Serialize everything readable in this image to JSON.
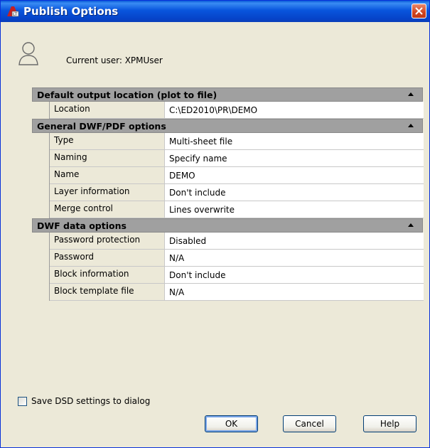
{
  "window": {
    "title": "Publish Options",
    "icons": {
      "app": "autocad-lt-icon",
      "close": "close-icon"
    }
  },
  "user": {
    "label": "Current user: XPMUser",
    "icon": "user-icon"
  },
  "sections": [
    {
      "title": "Default output location (plot to file)",
      "rows": [
        {
          "name": "Location",
          "value": "C:\\ED2010\\PR\\DEMO"
        }
      ]
    },
    {
      "title": "General DWF/PDF options",
      "rows": [
        {
          "name": "Type",
          "value": "Multi-sheet file"
        },
        {
          "name": "Naming",
          "value": "Specify name"
        },
        {
          "name": "Name",
          "value": "DEMO"
        },
        {
          "name": "Layer information",
          "value": "Don't include"
        },
        {
          "name": "Merge control",
          "value": "Lines overwrite"
        }
      ]
    },
    {
      "title": "DWF data options",
      "rows": [
        {
          "name": "Password protection",
          "value": "Disabled"
        },
        {
          "name": "Password",
          "value": "N/A"
        },
        {
          "name": "Block information",
          "value": "Don't include"
        },
        {
          "name": "Block template file",
          "value": "N/A"
        }
      ]
    }
  ],
  "save_dsd": {
    "label": "Save DSD settings to dialog",
    "checked": false
  },
  "buttons": {
    "ok": "OK",
    "cancel": "Cancel",
    "help": "Help"
  },
  "colors": {
    "titlebar": "#0855dd",
    "section_header": "#a0a0a0",
    "dialog_bg": "#ece9d8"
  }
}
